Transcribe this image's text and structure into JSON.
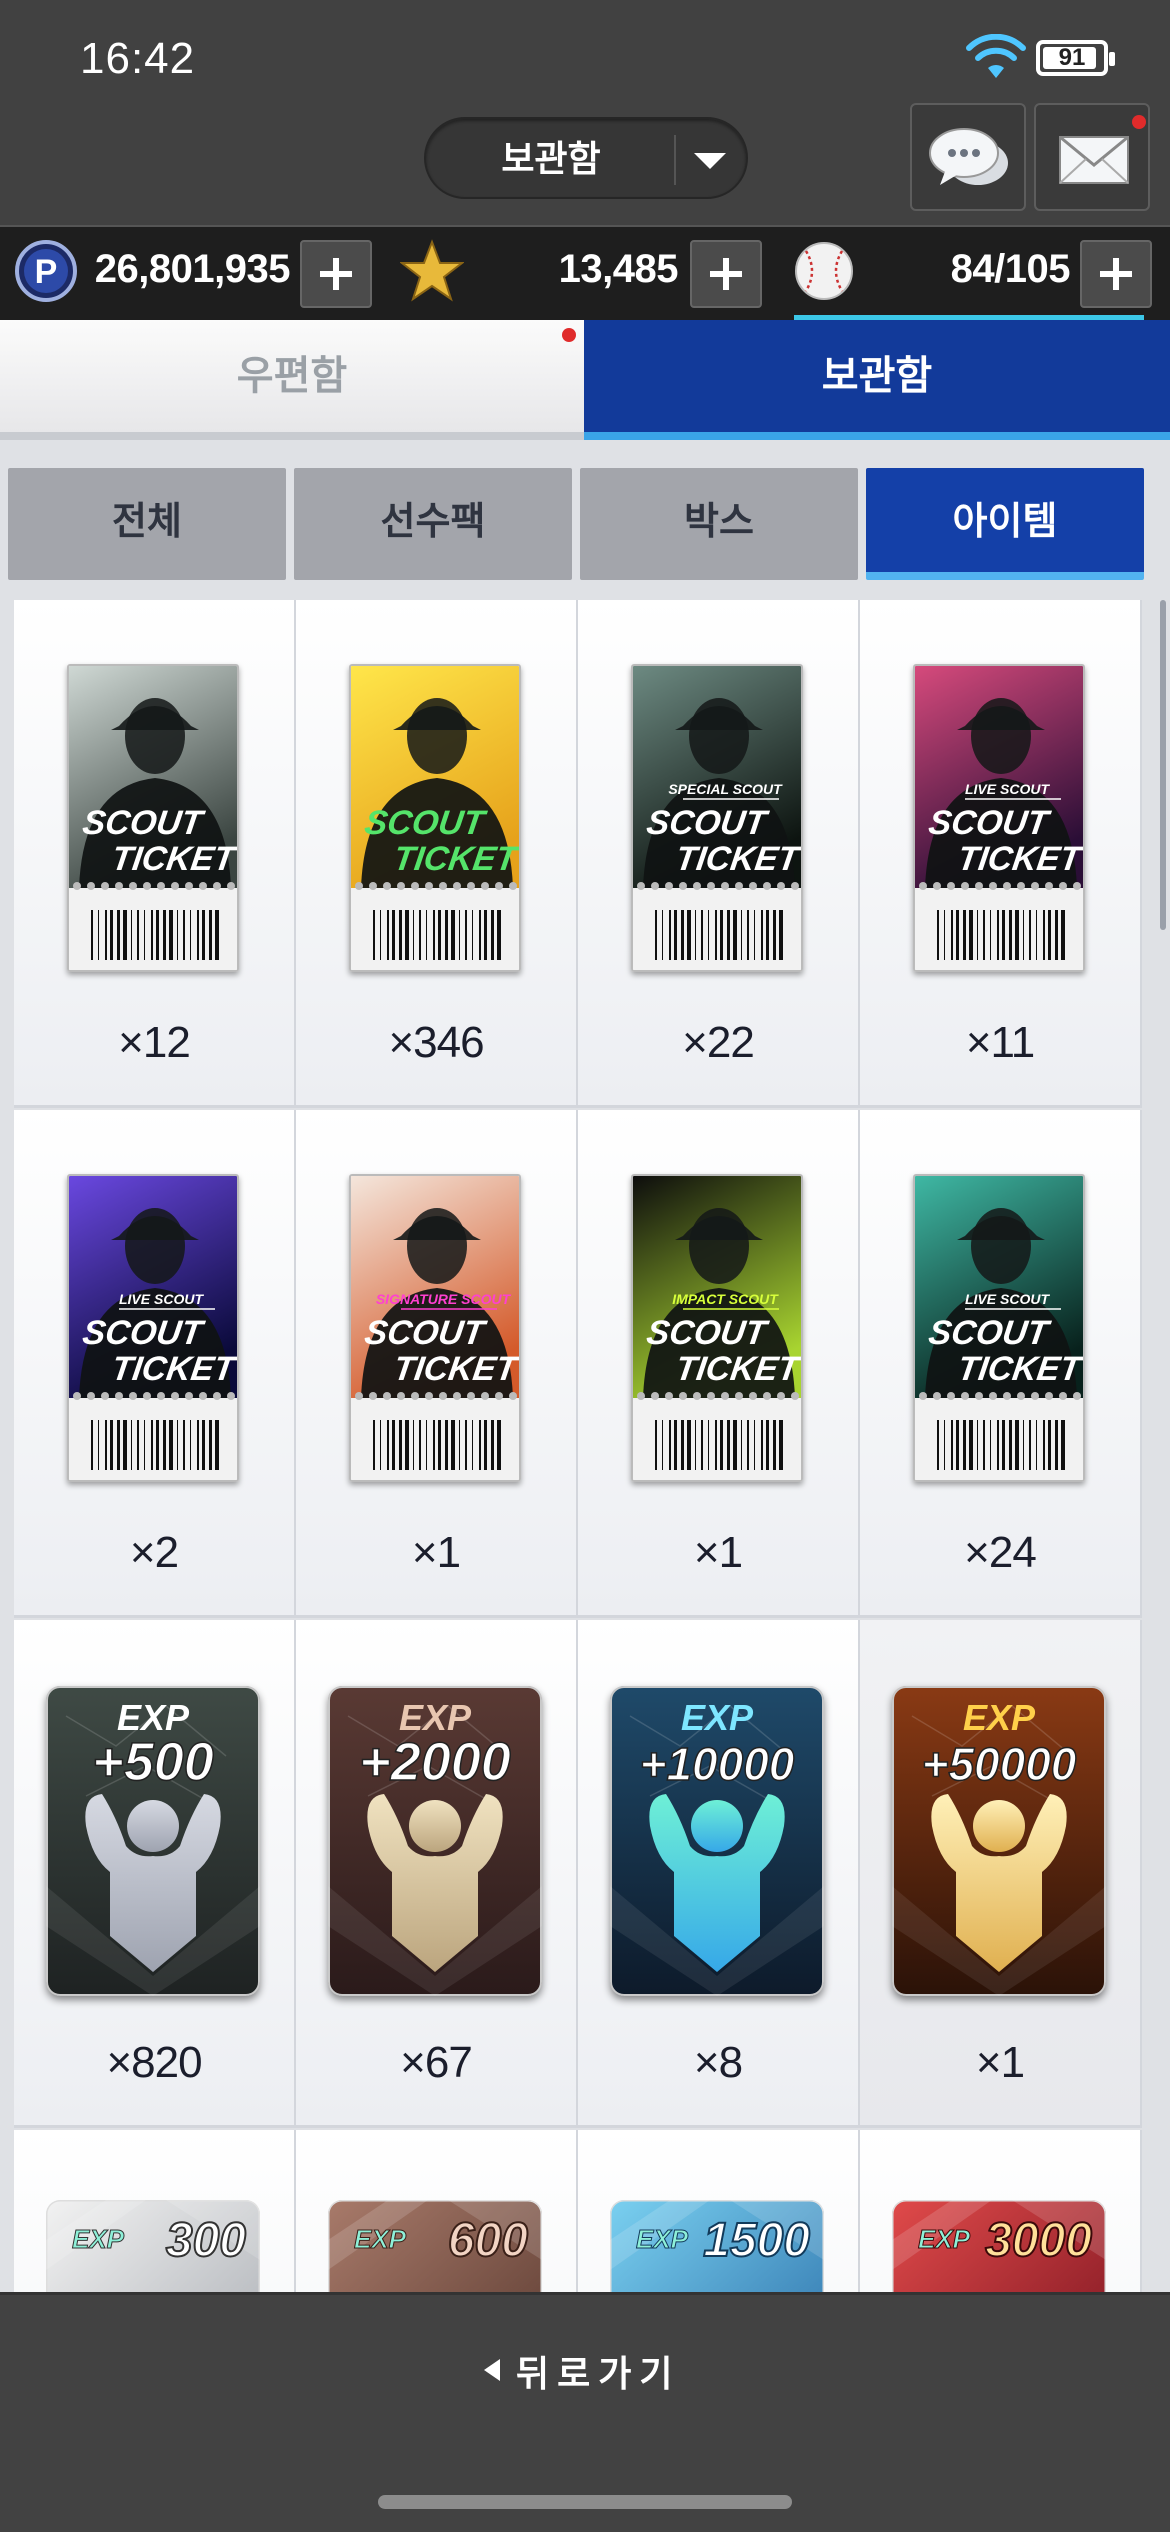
{
  "status": {
    "time": "16:42",
    "battery": "91",
    "battery_level": 0.91
  },
  "header": {
    "dropdown_label": "보관함",
    "chat_icon": "chat-bubble-icon",
    "mail_icon": "envelope-icon"
  },
  "currency": {
    "points": "26,801,935",
    "stars": "13,485",
    "balls": "84/105"
  },
  "main_tabs": [
    {
      "label": "우편함",
      "active": false
    },
    {
      "label": "보관함",
      "active": true
    }
  ],
  "sub_tabs": [
    {
      "label": "전체",
      "active": false
    },
    {
      "label": "선수팩",
      "active": false
    },
    {
      "label": "박스",
      "active": false
    },
    {
      "label": "아이템",
      "active": true
    }
  ],
  "items": [
    {
      "kind": "ticket",
      "label": "SCOUT",
      "subtype": "",
      "count": "×12",
      "theme": "gray"
    },
    {
      "kind": "ticket",
      "label": "SCOUT",
      "subtype": "",
      "count": "×346",
      "theme": "yellow"
    },
    {
      "kind": "ticket",
      "label": "SCOUT",
      "subtype": "SPECIAL SCOUT",
      "count": "×22",
      "theme": "stadium"
    },
    {
      "kind": "ticket",
      "label": "SCOUT",
      "subtype": "LIVE SCOUT",
      "count": "×11",
      "theme": "purple"
    },
    {
      "kind": "ticket",
      "label": "SCOUT",
      "subtype": "LIVE SCOUT",
      "count": "×2",
      "theme": "violet"
    },
    {
      "kind": "ticket",
      "label": "SCOUT",
      "subtype": "SIGNATURE SCOUT",
      "count": "×1",
      "theme": "signature"
    },
    {
      "kind": "ticket",
      "label": "SCOUT",
      "subtype": "IMPACT SCOUT",
      "count": "×1",
      "theme": "impact"
    },
    {
      "kind": "ticket",
      "label": "SCOUT",
      "subtype": "LIVE SCOUT",
      "count": "×24",
      "theme": "teal"
    },
    {
      "kind": "exp",
      "exp_label": "EXP",
      "amount": "+500",
      "count": "×820",
      "theme": "gray"
    },
    {
      "kind": "exp",
      "exp_label": "EXP",
      "amount": "+2000",
      "count": "×67",
      "theme": "bronze"
    },
    {
      "kind": "exp",
      "exp_label": "EXP",
      "amount": "+10000",
      "count": "×8",
      "theme": "blue"
    },
    {
      "kind": "exp",
      "exp_label": "EXP",
      "amount": "+50000",
      "count": "×1",
      "theme": "gold"
    },
    {
      "kind": "expsmall",
      "exp_label": "EXP",
      "amount": "300",
      "count": "",
      "theme": "silver"
    },
    {
      "kind": "expsmall",
      "exp_label": "EXP",
      "amount": "600",
      "count": "",
      "theme": "brown"
    },
    {
      "kind": "expsmall",
      "exp_label": "EXP",
      "amount": "1500",
      "count": "",
      "theme": "sky"
    },
    {
      "kind": "expsmall",
      "exp_label": "EXP",
      "amount": "3000",
      "count": "",
      "theme": "red"
    }
  ],
  "ticket_word": "TICKET",
  "bottom": {
    "back_label": "뒤로가기"
  },
  "colors": {
    "accent": "#123a9a",
    "highlight": "#3aa4e8",
    "badge": "#e02b2b"
  }
}
